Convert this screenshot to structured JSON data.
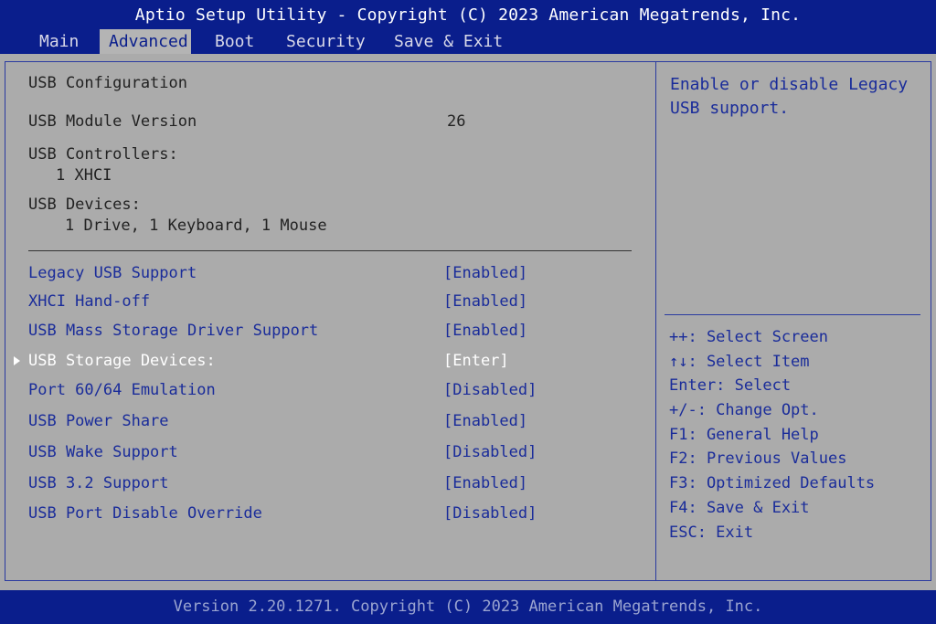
{
  "header": {
    "title": "Aptio Setup Utility - Copyright (C) 2023 American Megatrends, Inc.",
    "tabs": [
      "Main",
      "Advanced",
      "Boot",
      "Security",
      "Save & Exit"
    ],
    "active_tab": "Advanced"
  },
  "main": {
    "section_title": "USB Configuration",
    "module_version_label": "USB Module Version",
    "module_version_value": "26",
    "controllers_label": "USB Controllers:",
    "controllers_value": "1 XHCI",
    "devices_label": "USB Devices:",
    "devices_value": "1 Drive, 1 Keyboard, 1 Mouse",
    "options": [
      {
        "label": "Legacy USB Support",
        "value": "[Enabled]"
      },
      {
        "label": "XHCI Hand-off",
        "value": "[Enabled]"
      },
      {
        "label": "USB Mass Storage Driver Support",
        "value": "[Enabled]"
      },
      {
        "label": "USB Storage Devices:",
        "value": "[Enter]"
      },
      {
        "label": "Port 60/64 Emulation",
        "value": "[Disabled]"
      },
      {
        "label": "USB Power Share",
        "value": "[Enabled]"
      },
      {
        "label": "USB Wake Support",
        "value": "[Disabled]"
      },
      {
        "label": "USB 3.2 Support",
        "value": "[Enabled]"
      },
      {
        "label": "USB Port Disable Override",
        "value": "[Disabled]"
      }
    ]
  },
  "help": {
    "text": "Enable or disable Legacy USB support.",
    "keys": [
      "++: Select Screen",
      "↑↓: Select Item",
      "Enter: Select",
      "+/-: Change Opt.",
      "F1: General Help",
      "F2: Previous Values",
      "F3: Optimized Defaults",
      "F4: Save & Exit",
      "ESC: Exit"
    ]
  },
  "footer": {
    "text": "Version 2.20.1271. Copyright (C) 2023 American Megatrends, Inc."
  },
  "colors": {
    "header_bg": "#0a1e8c",
    "panel_bg": "#ababab",
    "option_text": "#1a2c9a",
    "selected_text": "#ffffff"
  }
}
